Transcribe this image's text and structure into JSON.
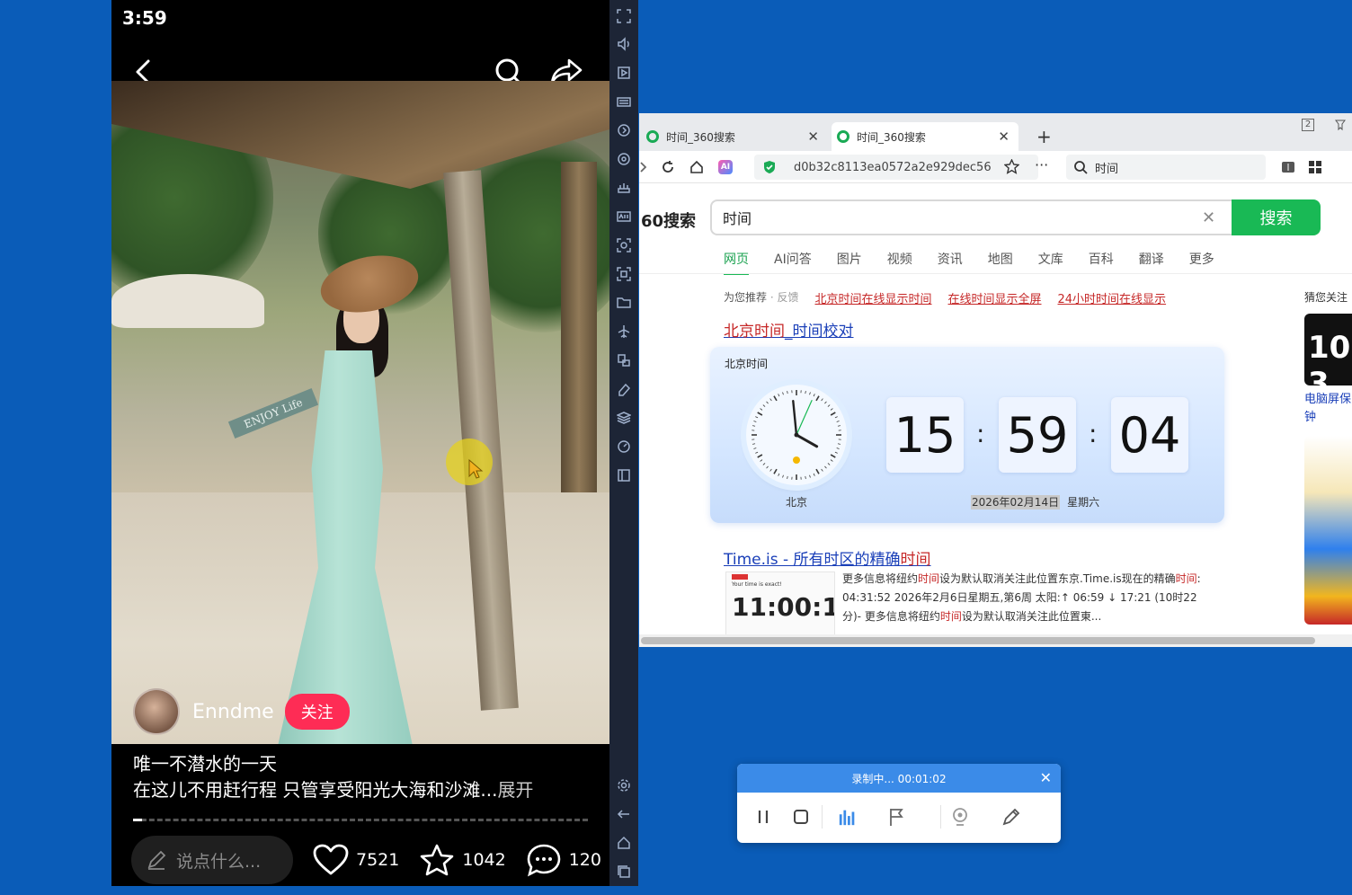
{
  "phone": {
    "status_time": "3:59",
    "author_name": "Enndme",
    "follow_label": "关注",
    "sign_text": "ENJOY Life",
    "caption_line1": "唯一不潜水的一天",
    "caption_line2": "在这儿不用赶行程 只管享受阳光大海和沙滩...",
    "caption_more": "展开",
    "video_progress": 0.02,
    "comment_placeholder": "说点什么...",
    "likes": "7521",
    "favorites": "1042",
    "comments": "120"
  },
  "emulator_toolbar": {
    "icons": [
      "fullscreen-icon",
      "volume-icon",
      "video-icon",
      "keyboard-icon",
      "rotate-icon",
      "location-icon",
      "install-icon",
      "apk-icon",
      "screenshot-icon",
      "record-icon",
      "folder-icon",
      "airplane-icon",
      "multi-window-icon",
      "erase-icon",
      "layers-icon",
      "speed-icon",
      "sidebar-icon",
      "settings-icon",
      "back-icon",
      "home-icon",
      "recent-apps-icon"
    ]
  },
  "browser": {
    "tabs": [
      {
        "title": "时间_360搜索",
        "active": false
      },
      {
        "title": "时间_360搜索",
        "active": true
      }
    ],
    "window_badge": "2",
    "url": "d0b32c8113ea0572a2e929dec56",
    "top_search_value": "时间",
    "serp": {
      "logo": "60搜索",
      "query": "时间",
      "search_button": "搜索",
      "tabs": [
        "网页",
        "AI问答",
        "图片",
        "视频",
        "资讯",
        "地图",
        "文库",
        "百科",
        "翻译",
        "更多"
      ],
      "active_tab": "网页",
      "recommend_label": "为您推荐",
      "feedback_label": "· 反馈",
      "recommend_links": [
        "北京时间在线显示时间",
        "在线时间显示全屏",
        "24小时时间在线显示"
      ],
      "result1_title_a": "北京时间",
      "result1_title_b": "_时间校对",
      "clock": {
        "label": "北京时间",
        "city": "北京",
        "hours": "15",
        "minutes": "59",
        "seconds": "04",
        "colon": ":",
        "date": "2026年02月14日",
        "weekday": "星期六"
      },
      "result2_title_a": "Time.is - 所有时区的精确",
      "result2_title_b": "时间",
      "result2_thumb_big": "11:00:1",
      "result2_thumb_small": "Your time is exact!",
      "result2_snippet": [
        {
          "t": "更多信息将纽约",
          "hl": false
        },
        {
          "t": "时间",
          "hl": true
        },
        {
          "t": "设为默认取消关注此位置东京.Time.is现在的精确",
          "hl": false
        },
        {
          "t": "时间",
          "hl": true
        },
        {
          "t": ": 04:31:52 2026年2月6日星期五,第6周 太阳:↑ 06:59 ↓ 17:21 (10时22分)- 更多信息将纽约",
          "hl": false
        },
        {
          "t": "时间",
          "hl": true
        },
        {
          "t": "设为默认取消关注此位置東...",
          "hl": false
        }
      ],
      "side_label": "猜您关注",
      "side_tile1": "10 3",
      "side_caption": "电脑屏保钟"
    }
  },
  "recorder": {
    "status": "录制中... 00:01:02"
  }
}
